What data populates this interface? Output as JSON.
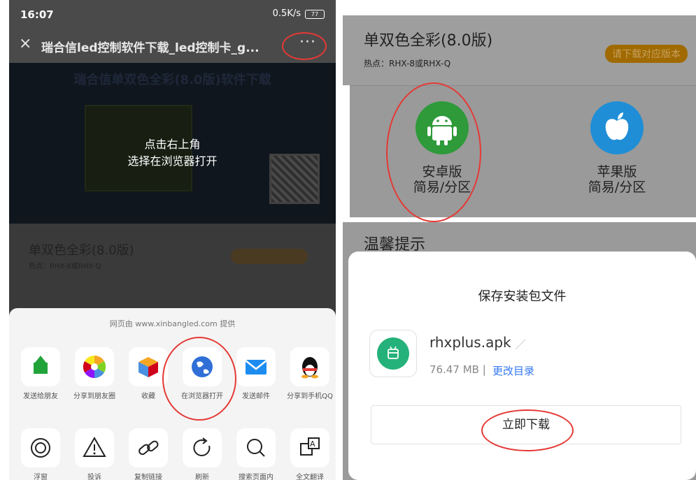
{
  "left": {
    "status": {
      "time": "16:07",
      "speed": "0.5K/s",
      "battery": "77"
    },
    "wechat_bar": {
      "close": "×",
      "title": "瑞合信led控制软件下载_led控制卡_g...",
      "more": "···"
    },
    "banner": {
      "title": "瑞合信单双色全彩(8.0版)软件下载",
      "tip_line1": "点击右上角",
      "tip_line2": "选择在浏览器打开"
    },
    "product_card": {
      "title": "单双色全彩(8.0版)",
      "subtitle": "热点：RHX-8或RHX-Q"
    },
    "share_sheet": {
      "hint": "网页由 www.xinbangled.com 提供",
      "row1": [
        {
          "label": "发送给朋友",
          "icon": "send-to-friend-icon"
        },
        {
          "label": "分享到朋友圈",
          "icon": "moments-icon"
        },
        {
          "label": "收藏",
          "icon": "favorite-cube-icon"
        },
        {
          "label": "在浏览器打开",
          "icon": "globe-icon"
        },
        {
          "label": "发送邮件",
          "icon": "mail-icon"
        },
        {
          "label": "分享到手机QQ",
          "icon": "qq-penguin-icon"
        }
      ],
      "row2": [
        {
          "label": "浮窗",
          "icon": "float-window-icon"
        },
        {
          "label": "投诉",
          "icon": "warning-icon"
        },
        {
          "label": "复制链接",
          "icon": "link-icon"
        },
        {
          "label": "刷新",
          "icon": "refresh-icon"
        },
        {
          "label": "搜索页面内",
          "icon": "search-icon"
        },
        {
          "label": "全文翻译",
          "icon": "translate-icon"
        }
      ]
    }
  },
  "right": {
    "product_card": {
      "title": "单双色全彩(8.0版)",
      "subtitle": "热点：RHX-8或RHX-Q",
      "badge": "请下载对应版本"
    },
    "versions": [
      {
        "line1": "安卓版",
        "line2": "简易/分区",
        "icon": "android-icon",
        "color": "#2e9a3a"
      },
      {
        "line1": "苹果版",
        "line2": "简易/分区",
        "icon": "apple-icon",
        "color": "#1f8ed6"
      }
    ],
    "notice_title": "温馨提示",
    "dialog": {
      "title": "保存安装包文件",
      "file_name": "rhxplus.apk",
      "file_size": "76.47 MB",
      "separator": "|",
      "change_dir": "更改目录",
      "download_button": "立即下载"
    }
  },
  "colors": {
    "highlight_ring": "#e53935",
    "link_blue": "#3478f6",
    "apk_green": "#25b27a"
  }
}
